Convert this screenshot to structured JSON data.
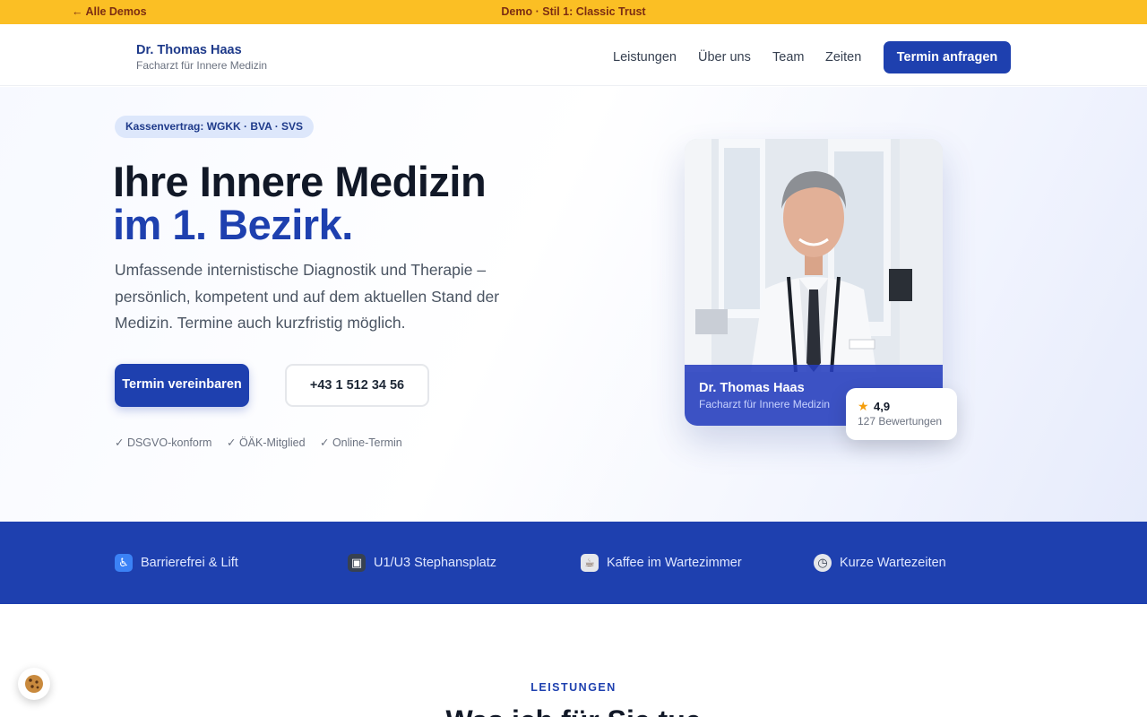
{
  "demo_bar": {
    "back_label": "← Alle Demos",
    "center_label": "Demo · Stil 1: Classic Trust"
  },
  "header": {
    "brand_name": "Dr. Thomas Haas",
    "brand_subtitle": "Facharzt für Innere Medizin",
    "nav": [
      "Leistungen",
      "Über uns",
      "Team",
      "Zeiten"
    ],
    "cta_label": "Termin anfragen"
  },
  "hero": {
    "badge": "Kassenvertrag: WGKK · BVA · SVS",
    "headline_line1": "Ihre Innere Medizin",
    "headline_line2": "im 1. Bezirk.",
    "lead": "Umfassende internistische Diagnostik und Therapie – persönlich, kompetent und auf dem aktuellen Stand der Medizin. Termine auch kurzfristig möglich.",
    "primary_button": "Termin vereinbaren",
    "phone_button": "+43 1 512 34 56",
    "trust_items": [
      "✓ DSGVO-konform",
      "✓ ÖÄK-Mitglied",
      "✓ Online-Termin"
    ]
  },
  "portrait_card": {
    "name": "Dr. Thomas Haas",
    "subtitle": "Facharzt für Innere Medizin",
    "rating_value": "4,9",
    "rating_count": "127 Bewertungen",
    "rating_icon": "star-icon"
  },
  "features": [
    {
      "icon": "wheelchair-icon",
      "label": "Barrierefrei & Lift"
    },
    {
      "icon": "metro-icon",
      "label": "U1/U3 Stephansplatz"
    },
    {
      "icon": "coffee-icon",
      "label": "Kaffee im Wartezimmer"
    },
    {
      "icon": "stopwatch-icon",
      "label": "Kurze Wartezeiten"
    }
  ],
  "services_section": {
    "kicker": "LEISTUNGEN",
    "title": "Was ich für Sie tue"
  },
  "colors": {
    "accent": "#1e40af",
    "demo_bar": "#fbbf24",
    "heading": "#111827"
  }
}
